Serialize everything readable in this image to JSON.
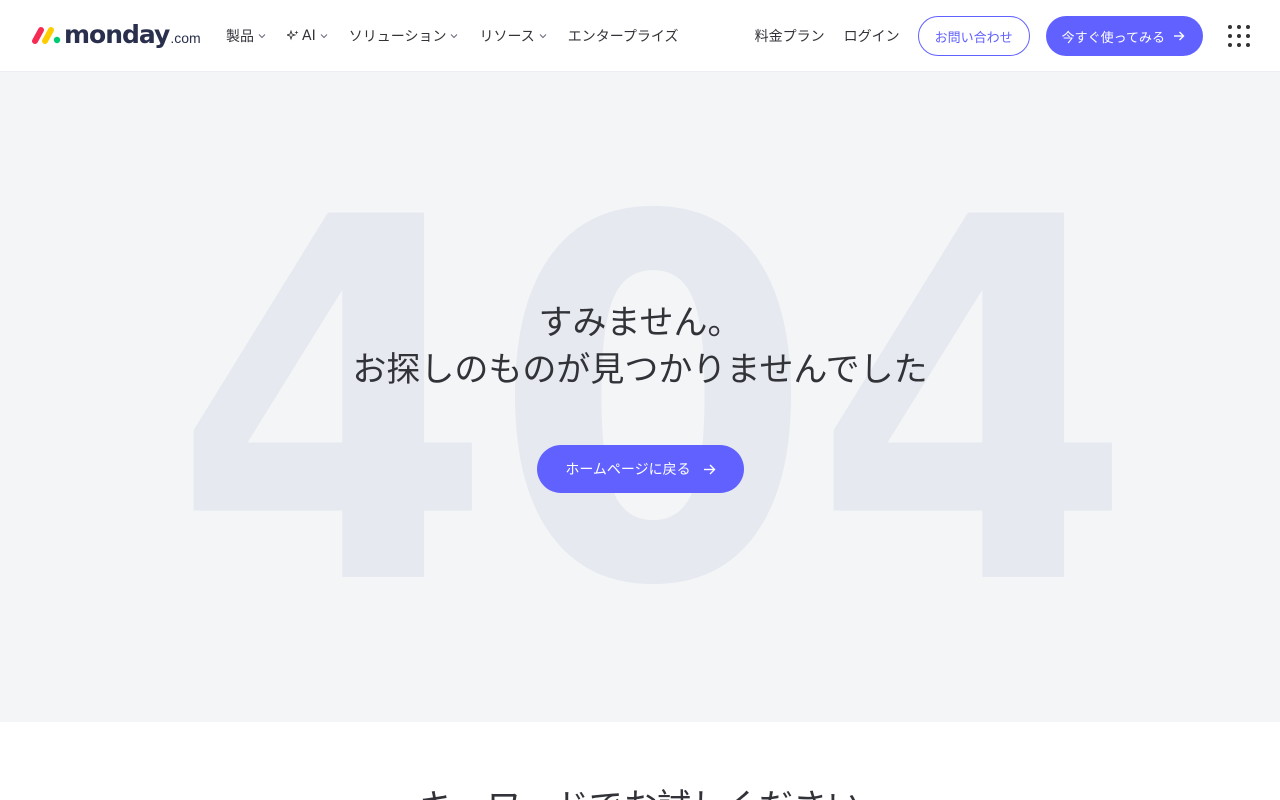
{
  "header": {
    "logo_text": "monday",
    "logo_tld": ".com",
    "nav": [
      {
        "label": "製品",
        "has_dropdown": true
      },
      {
        "label": "AI",
        "has_dropdown": true,
        "icon": "sparkle-icon"
      },
      {
        "label": "ソリューション",
        "has_dropdown": true
      },
      {
        "label": "リソース",
        "has_dropdown": true
      },
      {
        "label": "エンタープライズ",
        "has_dropdown": false
      }
    ],
    "pricing_label": "料金プラン",
    "login_label": "ログイン",
    "contact_label": "お問い合わせ",
    "cta_label": "今すぐ使ってみる",
    "menu_icon": "apps-grid-icon"
  },
  "hero": {
    "bg_code": "404",
    "line1": "すみません。",
    "line2": "お探しのものが見つかりませんでした",
    "home_button_label": "ホームページに戻る"
  },
  "bottom": {
    "title": "キーワードでお試しください"
  },
  "colors": {
    "accent": "#6161ff",
    "hero_bg": "#f3f5f7",
    "bg_digits": "#e6e9ef",
    "text": "#323338"
  }
}
